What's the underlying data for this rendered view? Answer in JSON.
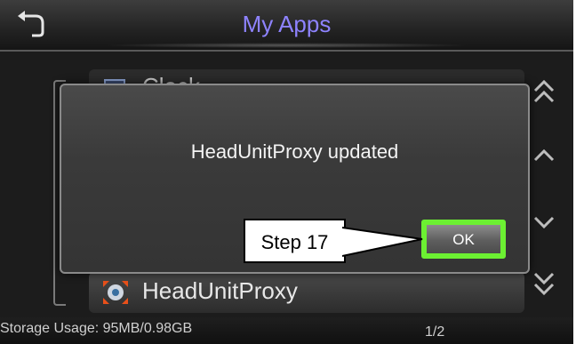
{
  "header": {
    "title": "My Apps",
    "back_icon": "back-arrow-icon"
  },
  "list": {
    "items": [
      {
        "label": "Clock",
        "icon": "clock-icon"
      },
      {
        "label": "HeadUnitProxy",
        "icon": "headunitproxy-icon"
      }
    ]
  },
  "scroll": {
    "icons": [
      "double-chevron-up-icon",
      "chevron-up-icon",
      "chevron-down-icon",
      "double-chevron-down-icon"
    ]
  },
  "footer": {
    "storage": "Storage Usage: 95MB/0.98GB",
    "page": "1/2"
  },
  "dialog": {
    "message": "HeadUnitProxy updated",
    "ok_label": "OK"
  },
  "annotation": {
    "label": "Step 17",
    "highlight_color": "#6cf032"
  },
  "colors": {
    "title": "#8e83ff",
    "background": "#1c1c1c"
  }
}
